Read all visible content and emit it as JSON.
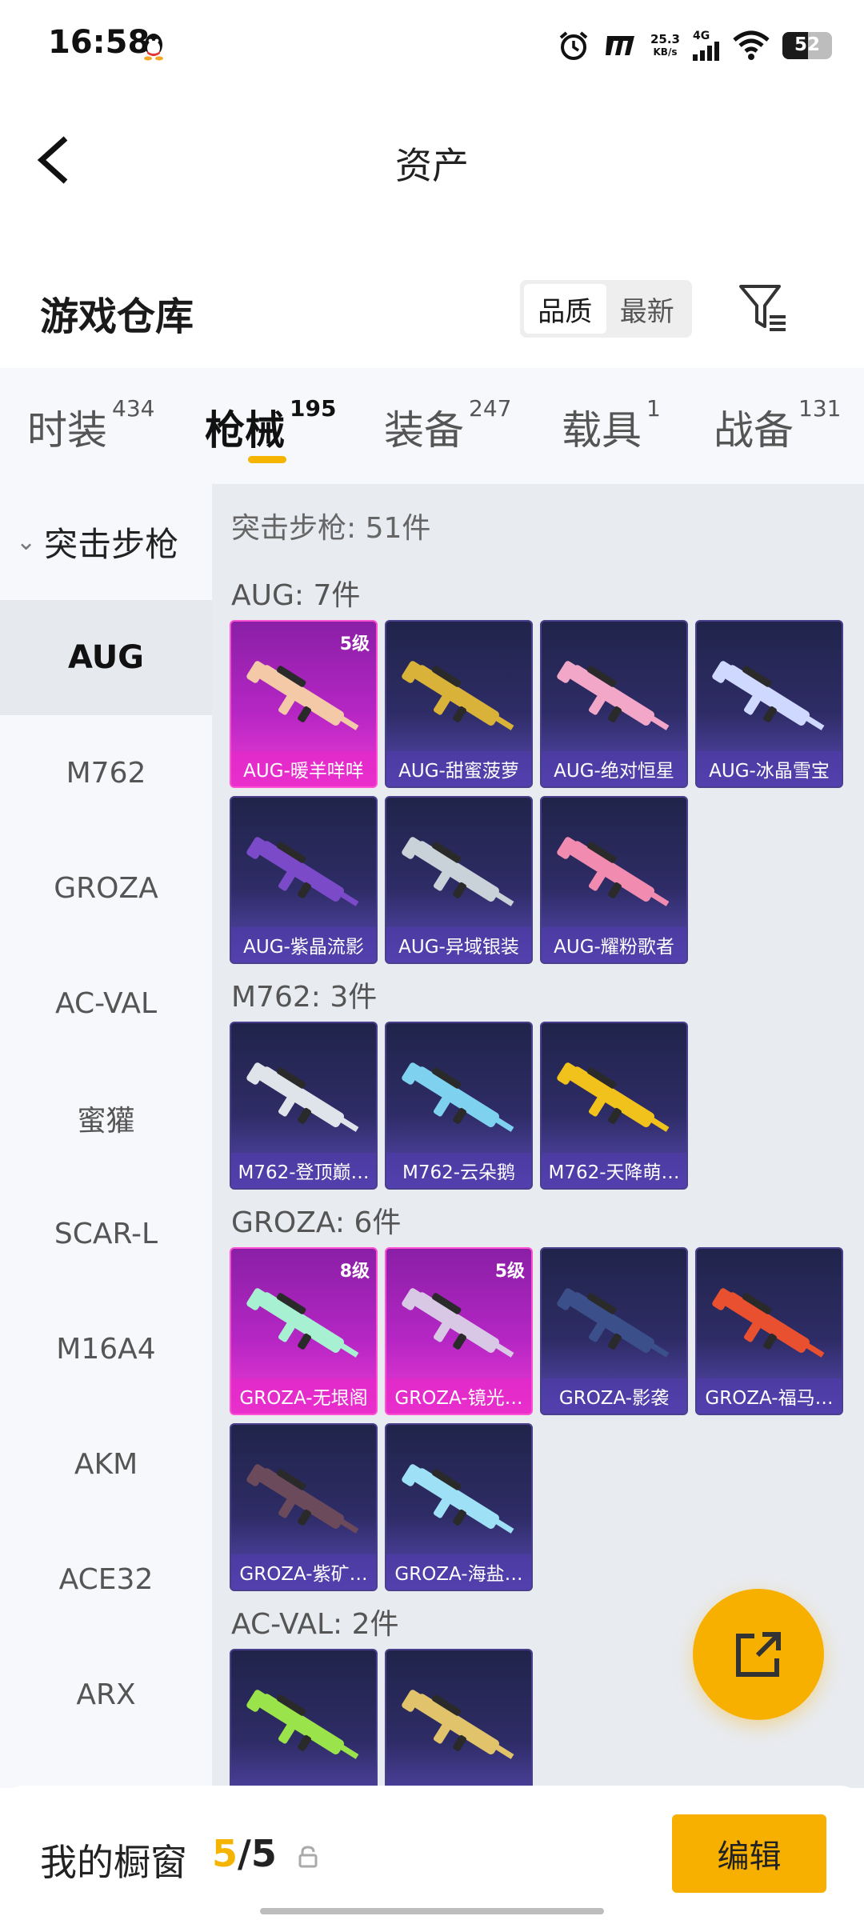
{
  "status_bar": {
    "time": "16:58",
    "speed_value": "25.3",
    "speed_unit": "KB/s",
    "network": "4G",
    "battery": "52",
    "battery_level": 0.52
  },
  "header": {
    "title": "资产"
  },
  "inventory": {
    "title": "游戏仓库",
    "sort_options": [
      "品质",
      "最新"
    ],
    "sort_selected": "品质"
  },
  "tabs": [
    {
      "label": "时装",
      "count": "434"
    },
    {
      "label": "枪械",
      "count": "195",
      "active": true
    },
    {
      "label": "装备",
      "count": "247"
    },
    {
      "label": "载具",
      "count": "1"
    },
    {
      "label": "战备",
      "count": "131"
    }
  ],
  "category": {
    "name": "突击步枪",
    "items": [
      "AUG",
      "M762",
      "GROZA",
      "AC-VAL",
      "蜜獾",
      "SCAR-L",
      "M16A4",
      "AKM",
      "ACE32",
      "ARX"
    ],
    "selected": "AUG"
  },
  "content": {
    "total_label": "突击步枪: 51件",
    "sections": [
      {
        "title": "AUG: 7件",
        "items": [
          {
            "name": "AUG-暖羊咩咩",
            "level": "5级",
            "rarity": "pink",
            "color": "#f3c9a8"
          },
          {
            "name": "AUG-甜蜜菠萝",
            "rarity": "purple",
            "color": "#d9b23a"
          },
          {
            "name": "AUG-绝对恒星",
            "rarity": "purple",
            "color": "#f2a6c8"
          },
          {
            "name": "AUG-冰晶雪宝",
            "rarity": "purple",
            "color": "#cfd8ff"
          },
          {
            "name": "AUG-紫晶流影",
            "rarity": "purple",
            "color": "#7b4ac9"
          },
          {
            "name": "AUG-异域银装",
            "rarity": "purple",
            "color": "#c9d2d9"
          },
          {
            "name": "AUG-耀粉歌者",
            "rarity": "purple",
            "color": "#f28bb0"
          }
        ]
      },
      {
        "title": "M762: 3件",
        "items": [
          {
            "name": "M762-登顶巅…",
            "rarity": "purple",
            "color": "#dfe3ea"
          },
          {
            "name": "M762-云朵鹅",
            "rarity": "purple",
            "color": "#7fd1f0"
          },
          {
            "name": "M762-天降萌…",
            "rarity": "purple",
            "color": "#f1c21c"
          }
        ]
      },
      {
        "title": "GROZA: 6件",
        "items": [
          {
            "name": "GROZA-无垠阁",
            "level": "8级",
            "rarity": "pink",
            "color": "#a8f0d2"
          },
          {
            "name": "GROZA-镜光…",
            "level": "5级",
            "rarity": "pink",
            "color": "#d9c7e6"
          },
          {
            "name": "GROZA-影袭",
            "rarity": "purple",
            "color": "#3b4f8a"
          },
          {
            "name": "GROZA-福马…",
            "rarity": "purple",
            "color": "#e8502f"
          },
          {
            "name": "GROZA-紫矿…",
            "rarity": "purple",
            "color": "#6b4a5c"
          },
          {
            "name": "GROZA-海盐…",
            "rarity": "purple",
            "color": "#9ee0f5"
          }
        ]
      },
      {
        "title": "AC-VAL: 2件",
        "items": [
          {
            "name": "",
            "rarity": "purple",
            "color": "#9be34a"
          },
          {
            "name": "",
            "rarity": "purple",
            "color": "#e0c36a"
          }
        ]
      }
    ]
  },
  "showcase": {
    "label": "我的橱窗",
    "current": "5",
    "separator": "/",
    "total": "5",
    "edit_label": "编辑"
  }
}
